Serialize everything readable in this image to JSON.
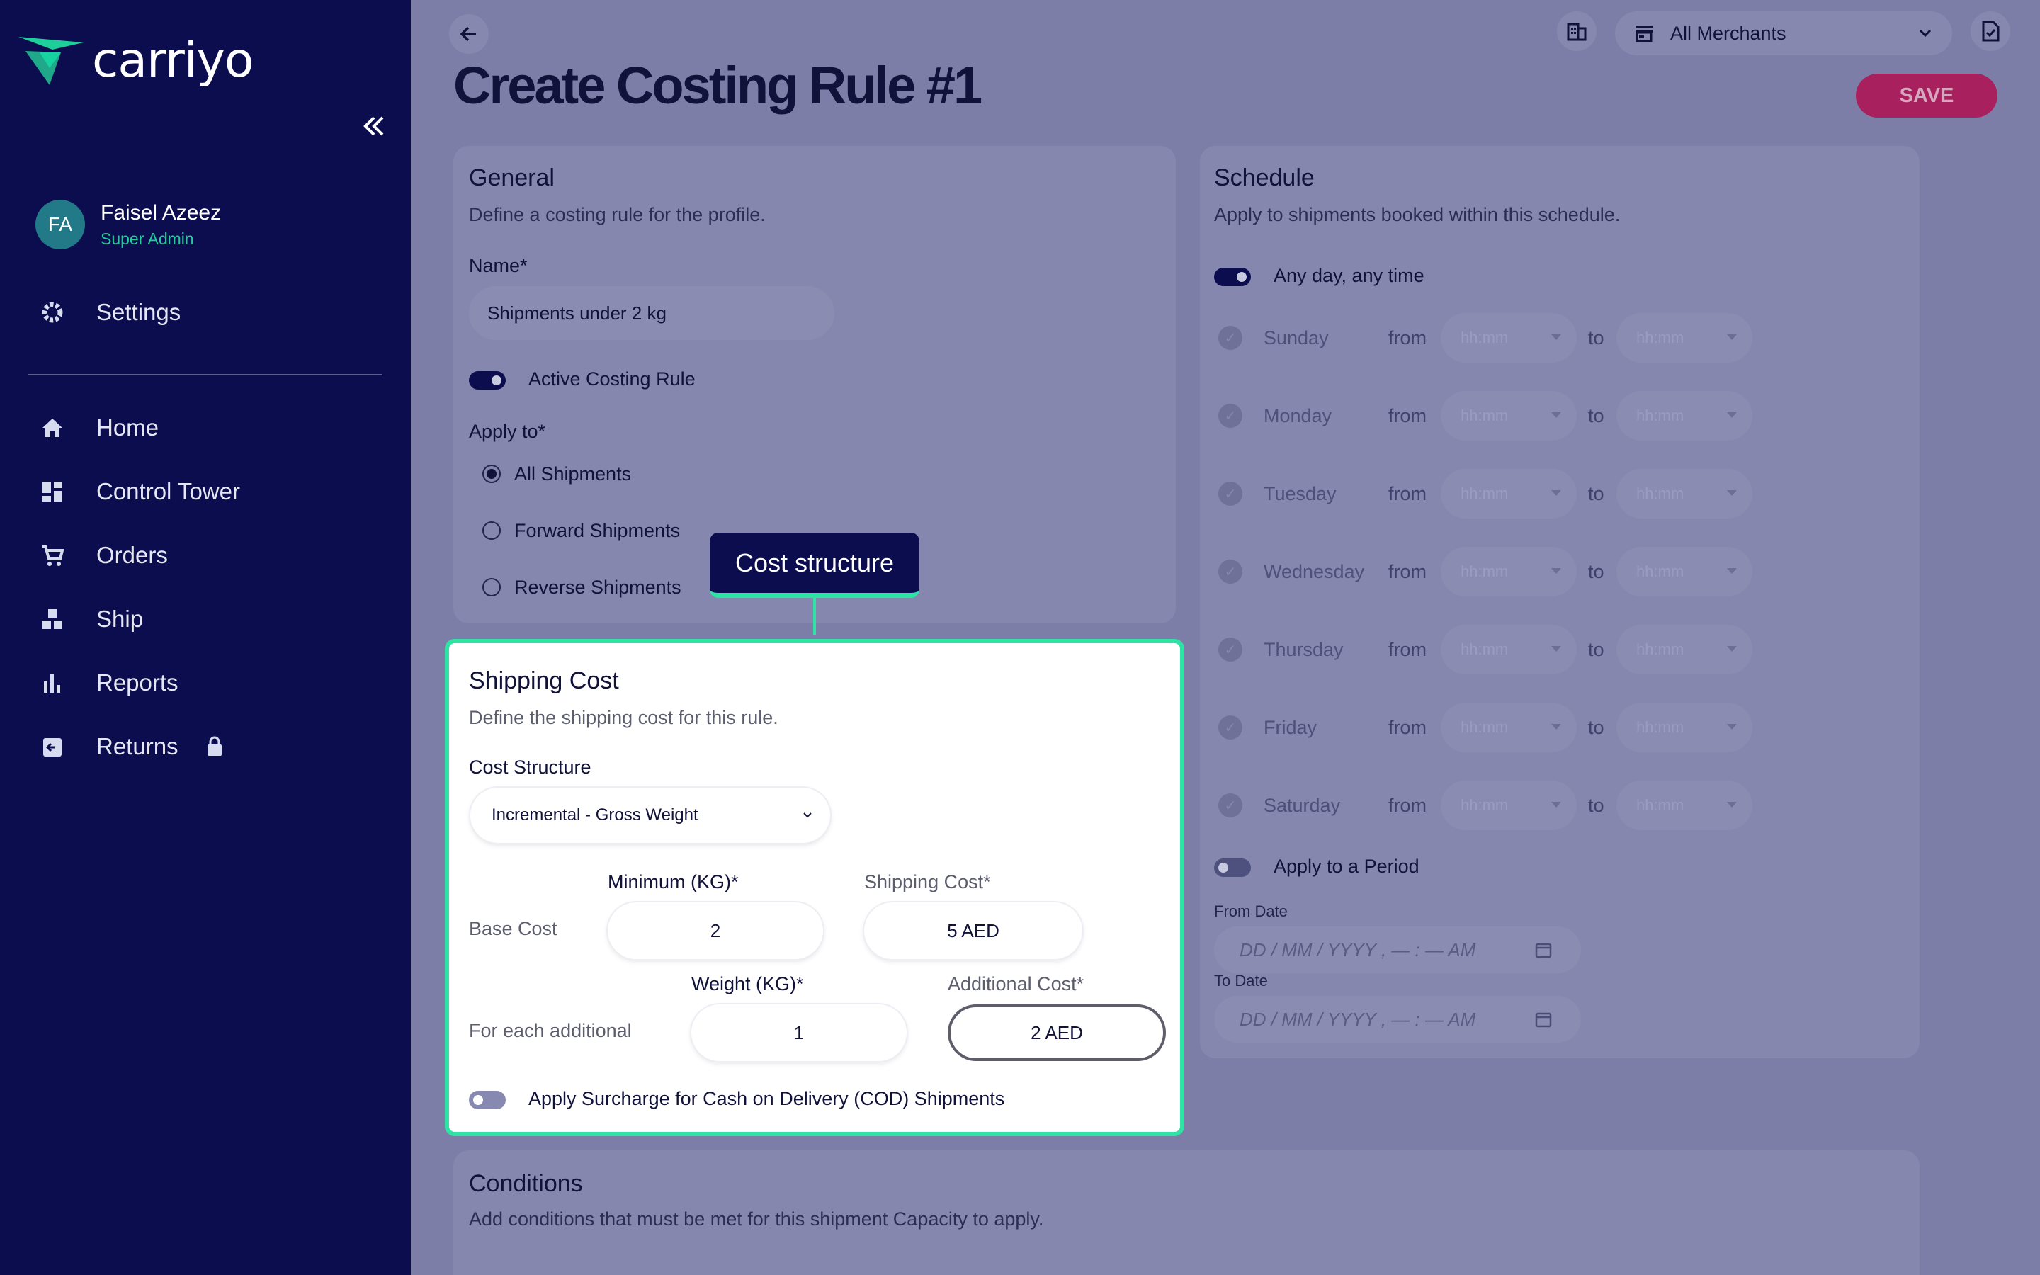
{
  "app": {
    "brand": "carriyo"
  },
  "user": {
    "initials": "FA",
    "name": "Faisel Azeez",
    "role": "Super Admin"
  },
  "sidebar": {
    "settings": "Settings",
    "items": [
      {
        "label": "Home",
        "icon": "home-icon"
      },
      {
        "label": "Control Tower",
        "icon": "dashboard-icon"
      },
      {
        "label": "Orders",
        "icon": "cart-icon"
      },
      {
        "label": "Ship",
        "icon": "ship-icon"
      },
      {
        "label": "Reports",
        "icon": "bar-chart-icon"
      },
      {
        "label": "Returns",
        "icon": "returns-icon"
      }
    ]
  },
  "header": {
    "merchant": "All Merchants",
    "title": "Create Costing Rule #1",
    "save": "SAVE"
  },
  "general": {
    "title": "General",
    "subtitle": "Define a costing rule for the profile.",
    "name_label": "Name*",
    "name_value": "Shipments under 2 kg",
    "active_label": "Active Costing Rule",
    "apply_label": "Apply to*",
    "options": [
      "All Shipments",
      "Forward Shipments",
      "Reverse Shipments"
    ],
    "selected": "All Shipments"
  },
  "tooltip": {
    "text": "Cost structure"
  },
  "shipping": {
    "title": "Shipping Cost",
    "subtitle": "Define the shipping cost for this rule.",
    "structure_label": "Cost Structure",
    "structure_value": "Incremental - Gross Weight",
    "base_label": "Base Cost",
    "min_label": "Minimum (KG)*",
    "min_value": "2",
    "ship_label": "Shipping Cost*",
    "ship_value": "5 AED",
    "additional_label": "For each additional",
    "weight_label": "Weight (KG)*",
    "weight_value": "1",
    "addcost_label": "Additional Cost*",
    "addcost_value": "2 AED",
    "cod_label": "Apply Surcharge for Cash on Delivery (COD) Shipments"
  },
  "schedule": {
    "title": "Schedule",
    "subtitle": "Apply to shipments booked within this schedule.",
    "any_time_label": "Any day, any time",
    "days": [
      "Sunday",
      "Monday",
      "Tuesday",
      "Wednesday",
      "Thursday",
      "Friday",
      "Saturday"
    ],
    "from": "from",
    "to": "to",
    "time_placeholder": "hh:mm",
    "period_label": "Apply to a Period",
    "from_date_label": "From Date",
    "to_date_label": "To Date",
    "date_placeholder": "DD / MM / YYYY ,  — : —   AM"
  },
  "conditions": {
    "title": "Conditions",
    "subtitle": "Add conditions that must be met for this shipment Capacity to apply."
  },
  "colors": {
    "sidebar": "#0c0d4f",
    "accent": "#2ee4a5",
    "save": "#a8205d",
    "overlay": "#7c7ea7"
  }
}
